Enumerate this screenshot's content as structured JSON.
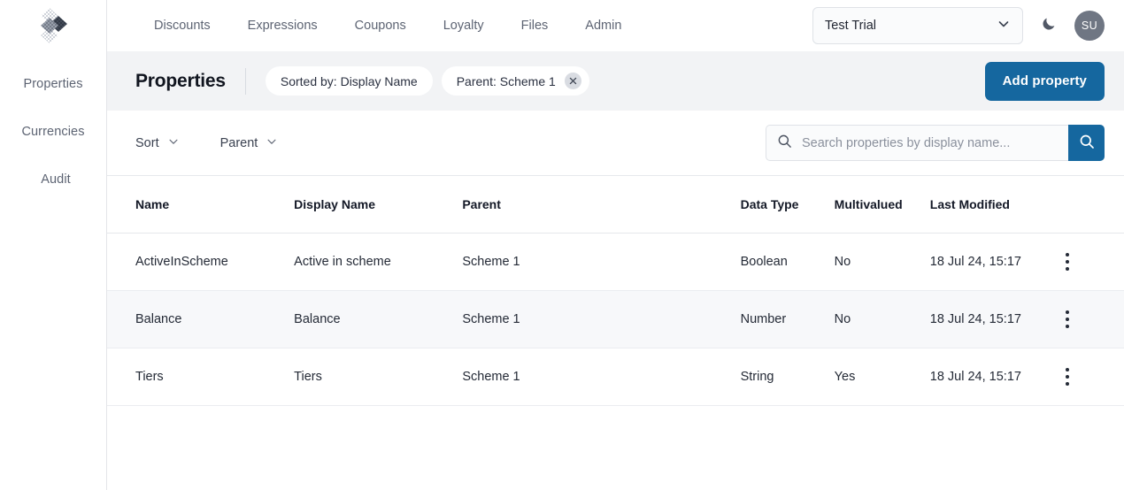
{
  "sidebar": {
    "logo_icon": "app-logo-diamond",
    "items": [
      {
        "label": "Properties",
        "name": "properties"
      },
      {
        "label": "Currencies",
        "name": "currencies"
      },
      {
        "label": "Audit",
        "name": "audit"
      }
    ]
  },
  "topnav": {
    "links": [
      {
        "label": "Discounts"
      },
      {
        "label": "Expressions"
      },
      {
        "label": "Coupons"
      },
      {
        "label": "Loyalty"
      },
      {
        "label": "Files"
      },
      {
        "label": "Admin"
      }
    ],
    "tenant": {
      "value": "Test Trial",
      "chevron_icon": "chevron-down-icon"
    },
    "theme_toggle_icon": "moon-icon",
    "avatar_initials": "SU"
  },
  "page_header": {
    "title": "Properties",
    "chips": [
      {
        "label": "Sorted by: Display Name",
        "removable": false
      },
      {
        "label": "Parent: Scheme 1",
        "removable": true,
        "remove_icon": "close-icon"
      }
    ],
    "add_button": "Add property"
  },
  "toolbar": {
    "filters": [
      {
        "label": "Sort",
        "icon": "chevron-down-icon"
      },
      {
        "label": "Parent",
        "icon": "chevron-down-icon"
      }
    ],
    "search": {
      "placeholder": "Search properties by display name...",
      "value": "",
      "leading_icon": "search-icon",
      "button_icon": "search-icon"
    }
  },
  "table": {
    "columns": [
      {
        "label": "Name"
      },
      {
        "label": "Display Name"
      },
      {
        "label": "Parent"
      },
      {
        "label": "Data Type"
      },
      {
        "label": "Multivalued"
      },
      {
        "label": "Last Modified"
      },
      {
        "label": ""
      }
    ],
    "rows": [
      {
        "name": "ActiveInScheme",
        "display_name": "Active in scheme",
        "parent": "Scheme 1",
        "data_type": "Boolean",
        "multivalued": "No",
        "last_modified": "18 Jul 24, 15:17",
        "menu_icon": "kebab-menu-icon"
      },
      {
        "name": "Balance",
        "display_name": "Balance",
        "parent": "Scheme 1",
        "data_type": "Number",
        "multivalued": "No",
        "last_modified": "18 Jul 24, 15:17",
        "menu_icon": "kebab-menu-icon"
      },
      {
        "name": "Tiers",
        "display_name": "Tiers",
        "parent": "Scheme 1",
        "data_type": "String",
        "multivalued": "Yes",
        "last_modified": "18 Jul 24, 15:17",
        "menu_icon": "kebab-menu-icon"
      }
    ]
  },
  "colors": {
    "accent": "#15679f",
    "header_band": "#f2f3f5",
    "alt_row": "#f7f8fa",
    "avatar": "#6f7683",
    "muted_text": "#5d6473"
  }
}
